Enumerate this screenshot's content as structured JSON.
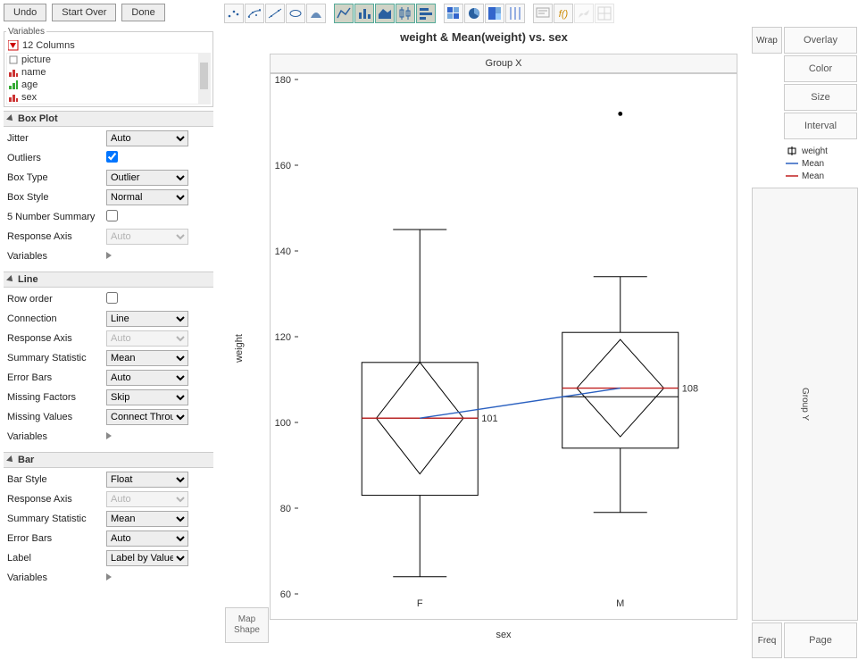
{
  "topbar": {
    "undo": "Undo",
    "startover": "Start Over",
    "done": "Done"
  },
  "variables": {
    "legend": "Variables",
    "cols_hdr": "12 Columns",
    "items": [
      "picture",
      "name",
      "age",
      "sex"
    ]
  },
  "sections": {
    "boxplot": {
      "title": "Box Plot",
      "rows": {
        "jitter": {
          "label": "Jitter",
          "value": "Auto"
        },
        "outliers": {
          "label": "Outliers"
        },
        "boxtype": {
          "label": "Box Type",
          "value": "Outlier"
        },
        "boxstyle": {
          "label": "Box Style",
          "value": "Normal"
        },
        "fivenum": {
          "label": "5 Number Summary"
        },
        "respaxis": {
          "label": "Response Axis",
          "value": "Auto"
        },
        "variables": {
          "label": "Variables"
        }
      }
    },
    "line": {
      "title": "Line",
      "rows": {
        "roworder": {
          "label": "Row order"
        },
        "connection": {
          "label": "Connection",
          "value": "Line"
        },
        "respaxis": {
          "label": "Response Axis",
          "value": "Auto"
        },
        "sumstat": {
          "label": "Summary Statistic",
          "value": "Mean"
        },
        "errbars": {
          "label": "Error Bars",
          "value": "Auto"
        },
        "missfac": {
          "label": "Missing Factors",
          "value": "Skip"
        },
        "missval": {
          "label": "Missing Values",
          "value": "Connect Throu"
        },
        "variables": {
          "label": "Variables"
        }
      }
    },
    "bar": {
      "title": "Bar",
      "rows": {
        "barstyle": {
          "label": "Bar Style",
          "value": "Float"
        },
        "respaxis": {
          "label": "Response Axis",
          "value": "Auto"
        },
        "sumstat": {
          "label": "Summary Statistic",
          "value": "Mean"
        },
        "errbars": {
          "label": "Error Bars",
          "value": "Auto"
        },
        "label": {
          "label": "Label",
          "value": "Label by Value"
        },
        "variables": {
          "label": "Variables"
        }
      }
    }
  },
  "right": {
    "wrap": "Wrap",
    "overlay": "Overlay",
    "color": "Color",
    "size": "Size",
    "interval": "Interval",
    "groupy": "Group Y",
    "freq": "Freq",
    "page": "Page",
    "legend": {
      "weight": "weight",
      "mean1": "Mean",
      "mean2": "Mean"
    }
  },
  "chart": {
    "title": "weight & Mean(weight) vs. sex",
    "groupx": "Group X",
    "mapshape": "Map\nShape",
    "ylabel": "weight",
    "xlabel": "sex"
  },
  "chart_data": {
    "type": "boxplot+line",
    "xlabel": "sex",
    "ylabel": "weight",
    "ylim": [
      60,
      180
    ],
    "yticks": [
      60,
      80,
      100,
      120,
      140,
      160,
      180
    ],
    "categories": [
      "F",
      "M"
    ],
    "boxplots": [
      {
        "category": "F",
        "min": 64,
        "q1": 83,
        "median": 101,
        "mean": 101,
        "q3": 114,
        "max": 145,
        "outliers": []
      },
      {
        "category": "M",
        "min": 79,
        "q1": 94,
        "median": 106,
        "mean": 108,
        "q3": 121,
        "max": 134,
        "outliers": [
          172
        ]
      }
    ],
    "mean_line": {
      "F": 101,
      "M": 108
    },
    "value_labels": {
      "F": "101",
      "M": "108"
    }
  }
}
